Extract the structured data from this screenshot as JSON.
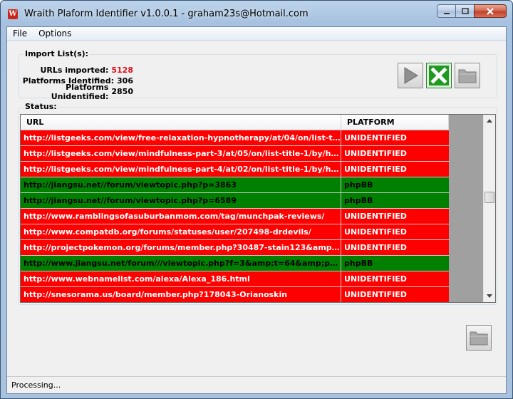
{
  "window": {
    "title": "Wraith Plaform Identifier v1.0.0.1 - graham23s@Hotmail.com",
    "icon": "app-logo-icon",
    "icon_letter": "W"
  },
  "menu": [
    "File",
    "Options"
  ],
  "import": {
    "group_title": "Import List(s):",
    "urls_imported_label": "URLs imported:",
    "urls_imported": "5128",
    "identified_label": "Platforms Identified:",
    "identified": "306",
    "unidentified_label": "Platforms Unidentified:",
    "unidentified": "2850"
  },
  "toolbar": {
    "play": "play-icon",
    "stop": "stop-x-icon",
    "open": "folder-icon"
  },
  "status": {
    "group_title": "Status:",
    "columns": [
      "URL",
      "PLATFORM"
    ],
    "rows": [
      {
        "url": "http://listgeeks.com/view/free-relaxation-hypnotherapy/at/04/on/list-title-1...",
        "platform": "UNIDENTIFIED"
      },
      {
        "url": "http://listgeeks.com/view/mindfulness-part-3/at/05/on/list-title-1/by/hypno...",
        "platform": "UNIDENTIFIED"
      },
      {
        "url": "http://listgeeks.com/view/mindfulness-part-4/at/02/on/list-title-1/by/hypno...",
        "platform": "UNIDENTIFIED"
      },
      {
        "url": "http://jiangsu.net//forum/viewtopic.php?p=3863",
        "platform": "phpBB"
      },
      {
        "url": "http://jiangsu.net//forum/viewtopic.php?p=6589",
        "platform": "phpBB"
      },
      {
        "url": "http://www.ramblingsofasuburbanmom.com/tag/munchpak-reviews/",
        "platform": "UNIDENTIFIED"
      },
      {
        "url": "http://www.compatdb.org/forums/statuses/user/207498-drdevils/",
        "platform": "UNIDENTIFIED"
      },
      {
        "url": "http://projectpokemon.org/forums/member.php?30487-stain123&amp;tab=a...",
        "platform": "UNIDENTIFIED"
      },
      {
        "url": "http://www.jiangsu.net/forum///viewtopic.php?f=3&amp;t=64&amp;p=6503",
        "platform": "phpBB"
      },
      {
        "url": "http://www.webnamelist.com/alexa/Alexa_186.html",
        "platform": "UNIDENTIFIED"
      },
      {
        "url": "http://snesorama.us/board/member.php?178043-Orianoskin",
        "platform": "UNIDENTIFIED"
      }
    ]
  },
  "colors": {
    "unidentified_row": "#ff0000",
    "identified_row": "#008000",
    "count_accent": "#e0141e"
  },
  "statusbar": {
    "text": "Processing..."
  }
}
